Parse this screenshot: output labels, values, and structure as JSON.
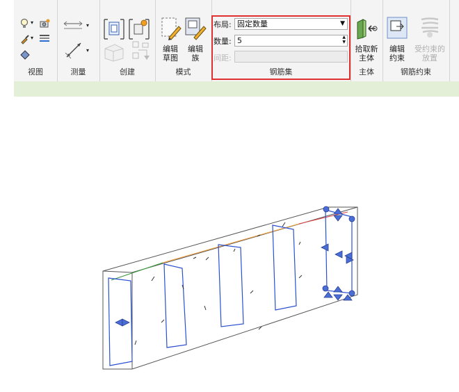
{
  "ribbon": {
    "panels": {
      "view": "视图",
      "measure": "测量",
      "create": "创建",
      "mode": "模式",
      "rebar_set": "钢筋集",
      "host": "主体",
      "rebar_constraint": "钢筋约束"
    },
    "mode": {
      "edit_sketch_line1": "编辑",
      "edit_sketch_line2": "草图",
      "edit_family_line1": "编辑",
      "edit_family_line2": "族"
    },
    "rebar_set": {
      "layout_label": "布局:",
      "layout_value": "固定数量",
      "quantity_label": "数量:",
      "quantity_value": "5",
      "spacing_label": "间距:",
      "spacing_value": ""
    },
    "host": {
      "pick_new_line1": "拾取新",
      "pick_new_line2": "主体"
    },
    "rebar_constraint": {
      "edit_line1": "编辑",
      "edit_line2": "约束",
      "placement_line1": "受约束的",
      "placement_line2": "放置"
    }
  },
  "icons": [
    "bulb-icon",
    "camera-icon",
    "brush-icon",
    "filter-icon",
    "eraser-icon",
    "measure-distance-icon",
    "dimension-icon",
    "group-icon",
    "create-component-icon",
    "similar-icon",
    "array-icon",
    "edit-sketch-icon",
    "edit-family-icon",
    "pick-host-icon",
    "edit-constraint-icon",
    "constrained-placement-icon"
  ],
  "colors": {
    "highlight": "#e03030",
    "rebar": "#2a4fcf",
    "ribbon_band": "#e4efd7"
  }
}
